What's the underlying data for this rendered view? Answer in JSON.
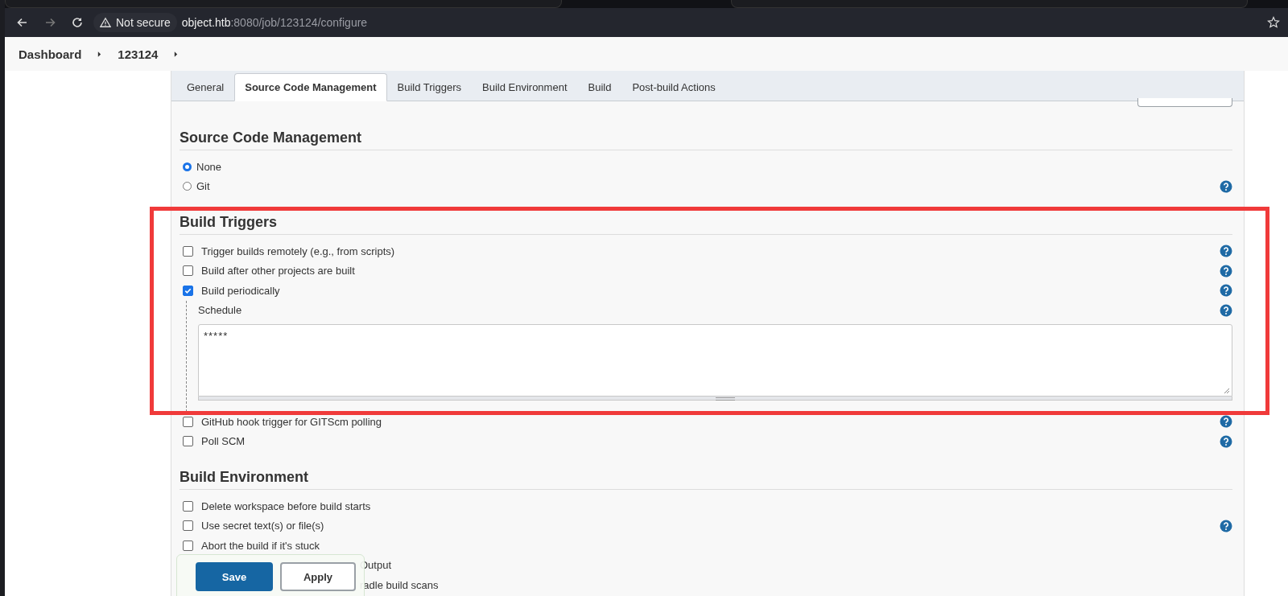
{
  "browser": {
    "security": "Not secure",
    "url_host": "object.htb",
    "url_path": ":8080/job/123124/configure"
  },
  "breadcrumb": [
    {
      "label": "Dashboard"
    },
    {
      "label": "123124"
    }
  ],
  "tabs": [
    {
      "label": "General",
      "selected": false
    },
    {
      "label": "Source Code Management",
      "selected": true
    },
    {
      "label": "Build Triggers",
      "selected": false
    },
    {
      "label": "Build Environment",
      "selected": false
    },
    {
      "label": "Build",
      "selected": false
    },
    {
      "label": "Post-build Actions",
      "selected": false
    }
  ],
  "sections": [
    {
      "title": "Source Code Management",
      "items": [
        {
          "kind": "radio",
          "label": "None",
          "selected": true,
          "help": false
        },
        {
          "kind": "radio",
          "label": "Git",
          "selected": false,
          "help": true
        }
      ]
    },
    {
      "title": "Build Triggers",
      "items": [
        {
          "kind": "checkbox",
          "label": "Trigger builds remotely (e.g., from scripts)",
          "checked": false,
          "help": true
        },
        {
          "kind": "checkbox",
          "label": "Build after other projects are built",
          "checked": false,
          "help": true
        },
        {
          "kind": "checkbox",
          "label": "Build periodically",
          "checked": true,
          "help": true,
          "fields": [
            {
              "label": "Schedule",
              "value": "*****",
              "help": true
            }
          ]
        },
        {
          "kind": "checkbox",
          "label": "GitHub hook trigger for GITScm polling",
          "checked": false,
          "help": true
        },
        {
          "kind": "checkbox",
          "label": "Poll SCM",
          "checked": false,
          "help": true
        }
      ]
    },
    {
      "title": "Build Environment",
      "items": [
        {
          "kind": "checkbox",
          "label": "Delete workspace before build starts",
          "checked": false,
          "help": false
        },
        {
          "kind": "checkbox",
          "label": "Use secret text(s) or file(s)",
          "checked": false,
          "help": true
        },
        {
          "kind": "checkbox",
          "label": "Abort the build if it's stuck",
          "checked": false,
          "help": false
        },
        {
          "kind": "partial",
          "label": "Output"
        },
        {
          "kind": "partial",
          "label": "radle build scans"
        }
      ]
    }
  ],
  "actions": [
    {
      "label": "Save",
      "kind": "primary"
    },
    {
      "label": "Apply",
      "kind": "secondary"
    }
  ]
}
